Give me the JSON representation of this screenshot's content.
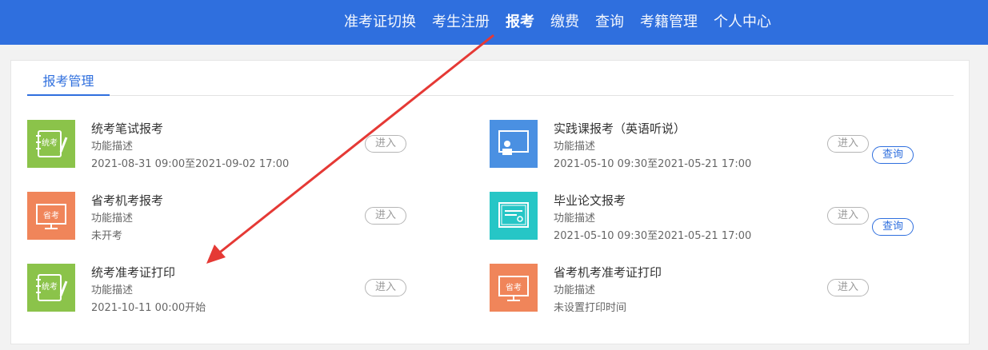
{
  "nav": {
    "items": [
      {
        "label": "准考证切换"
      },
      {
        "label": "考生注册"
      },
      {
        "label": "报考"
      },
      {
        "label": "缴费"
      },
      {
        "label": "查询"
      },
      {
        "label": "考籍管理"
      },
      {
        "label": "个人中心"
      }
    ],
    "active": "报考"
  },
  "tab": {
    "label": "报考管理"
  },
  "buttons": {
    "enter": "进入",
    "query": "查询"
  },
  "icons": {
    "tongkao": "统考",
    "shengkao": "省考"
  },
  "cards": [
    {
      "title": "统考笔试报考",
      "desc": "功能描述",
      "time": "2021-08-31 09:00至2021-09-02 17:00",
      "icon": "tongkao-notebook-icon",
      "color": "#8bc34a"
    },
    {
      "title": "实践课报考（英语听说）",
      "desc": "功能描述",
      "time": "2021-05-10 09:30至2021-05-21 17:00",
      "icon": "presentation-board-icon",
      "color": "#4a90e2"
    },
    {
      "title": "省考机考报考",
      "desc": "功能描述",
      "time": "未开考",
      "icon": "shengkao-monitor-icon",
      "color": "#f0855a"
    },
    {
      "title": "毕业论文报考",
      "desc": "功能描述",
      "time": "2021-05-10 09:30至2021-05-21 17:00",
      "icon": "certificate-icon",
      "color": "#26c6c6"
    },
    {
      "title": "统考准考证打印",
      "desc": "功能描述",
      "time": "2021-10-11 00:00开始",
      "icon": "tongkao-notebook-icon",
      "color": "#8bc34a"
    },
    {
      "title": "省考机考准考证打印",
      "desc": "功能描述",
      "time": "未设置打印时间",
      "icon": "shengkao-monitor-icon",
      "color": "#f0855a"
    }
  ],
  "annotation": {
    "arrow_color": "#e53935"
  }
}
